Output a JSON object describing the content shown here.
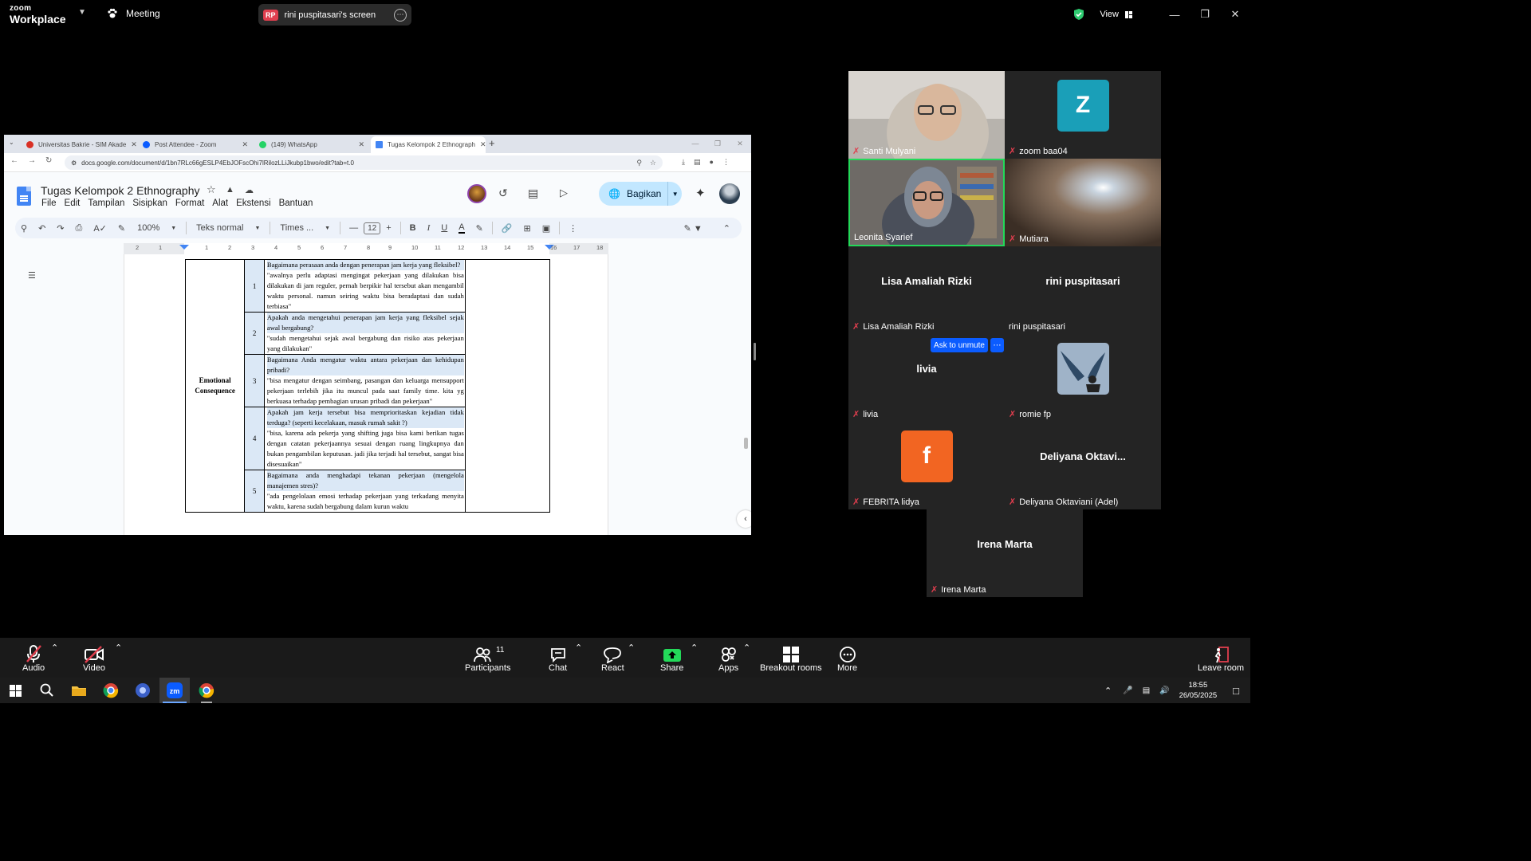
{
  "zoom": {
    "logo_top": "zoom",
    "logo_bottom": "Workplace",
    "meeting_label": "Meeting",
    "screen_share": {
      "initials": "RP",
      "label": "rini puspitasari's screen"
    },
    "view_label": "View"
  },
  "browser": {
    "tabs": [
      {
        "label": "Universitas Bakrie - SIM Akade",
        "color": "#d93025"
      },
      {
        "label": "Post Attendee - Zoom",
        "color": "#0b5cff"
      },
      {
        "label": "(149) WhatsApp",
        "color": "#25d366"
      },
      {
        "label": "Tugas Kelompok 2 Ethnograph",
        "color": "#4285f4"
      }
    ],
    "url": "docs.google.com/document/d/1bn7RLc66gESLP4EbJOFscOhi7lRilozLLiJkubp1bwo/edit?tab=t.0"
  },
  "docs": {
    "title": "Tugas Kelompok 2 Ethnography",
    "menus": [
      "File",
      "Edit",
      "Tampilan",
      "Sisipkan",
      "Format",
      "Alat",
      "Ekstensi",
      "Bantuan"
    ],
    "share_label": "Bagikan",
    "toolbar": {
      "zoom": "100%",
      "style": "Teks normal",
      "font": "Times ...",
      "font_size": "12"
    },
    "ruler": [
      "2",
      "1",
      "1",
      "2",
      "3",
      "4",
      "5",
      "6",
      "7",
      "8",
      "9",
      "10",
      "11",
      "12",
      "13",
      "14",
      "15",
      "16",
      "17",
      "18"
    ],
    "table": {
      "category": "Emotional Consequence",
      "rows": [
        {
          "num": "1",
          "question": "Bagaimana perasaan anda dengan penerapan jam kerja yang fleksibel?",
          "answer": "\"awalnya perlu adaptasi mengingat pekerjaan yang dilakukan bisa dilakukan di jam reguler, pernah berpikir hal tersebut akan mengambil waktu personal. namun seiring waktu bisa beradaptasi dan sudah terbiasa\""
        },
        {
          "num": "2",
          "question": "Apakah anda mengetahui penerapan jam kerja yang fleksibel sejak awal bergabung?",
          "answer": "\"sudah mengetahui sejak awal bergabung dan risiko atas pekerjaan yang dilakukan\""
        },
        {
          "num": "3",
          "question": "Bagaimana Anda mengatur waktu antara pekerjaan dan kehidupan pribadi?",
          "answer": "\"bisa mengatur dengan seimbang, pasangan dan keluarga mensupport pekerjaan terlebih jika itu muncul pada saat family time. kita yg berkuasa terhadap pembagian urusan pribadi dan pekerjaan\""
        },
        {
          "num": "4",
          "question": "Apakah jam kerja tersebut bisa memprioritaskan kejadian tidak terduga? (seperti kecelakaan, masuk rumah sakit ?)",
          "answer": "\"bisa, karena ada pekerja yang shifting juga bisa kami berikan tugas dengan catatan pekerjaannya sesuai dengan ruang lingkupnya dan bukan pengambilan keputusan. jadi jika terjadi hal tersebut, sangat bisa disesuaikan\""
        },
        {
          "num": "5",
          "question": "Bagaimana anda menghadapi tekanan pekerjaan (mengelola manajemen stres)?",
          "answer": "\"ada pengelolaan emosi terhadap pekerjaan yang terkadang menyita waktu, karena sudah bergabung dalam kurun waktu"
        }
      ]
    }
  },
  "participants": {
    "tiles": [
      {
        "name": "Santi Mulyani",
        "type": "video-santi",
        "muted": true
      },
      {
        "name": "zoom baa04",
        "type": "letter",
        "letter": "Z",
        "color": "#1a9fb8",
        "muted": true
      },
      {
        "name": "Leonita Syarief",
        "type": "video-leonita",
        "muted": false,
        "active": true
      },
      {
        "name": "Mutiara",
        "type": "video-mutiara",
        "muted": true
      },
      {
        "name": "Lisa Amaliah Rizki",
        "type": "text",
        "big": "Lisa Amaliah Rizki",
        "muted": true
      },
      {
        "name": "rini puspitasari",
        "type": "text",
        "big": "rini puspitasari",
        "muted": false
      },
      {
        "name": "livia",
        "type": "text",
        "big": "livia",
        "muted": true
      },
      {
        "name": "romie fp",
        "type": "avatar-romie",
        "muted": true
      },
      {
        "name": "FEBRITA lidya",
        "type": "letter",
        "letter": "f",
        "color": "#f26522",
        "muted": true
      },
      {
        "name": "Deliyana Oktaviani (Adel)",
        "type": "text",
        "big": "Deliyana  Oktavi...",
        "muted": true
      },
      {
        "name": "Irena Marta",
        "type": "text",
        "big": "Irena Marta",
        "muted": true
      }
    ],
    "ask_unmute": "Ask to unmute"
  },
  "controls": {
    "audio": "Audio",
    "video": "Video",
    "participants": "Participants",
    "participants_count": "11",
    "chat": "Chat",
    "react": "React",
    "share": "Share",
    "apps": "Apps",
    "breakout": "Breakout rooms",
    "more": "More",
    "leave": "Leave room"
  },
  "taskbar": {
    "time": "18:55",
    "date": "26/05/2025"
  }
}
